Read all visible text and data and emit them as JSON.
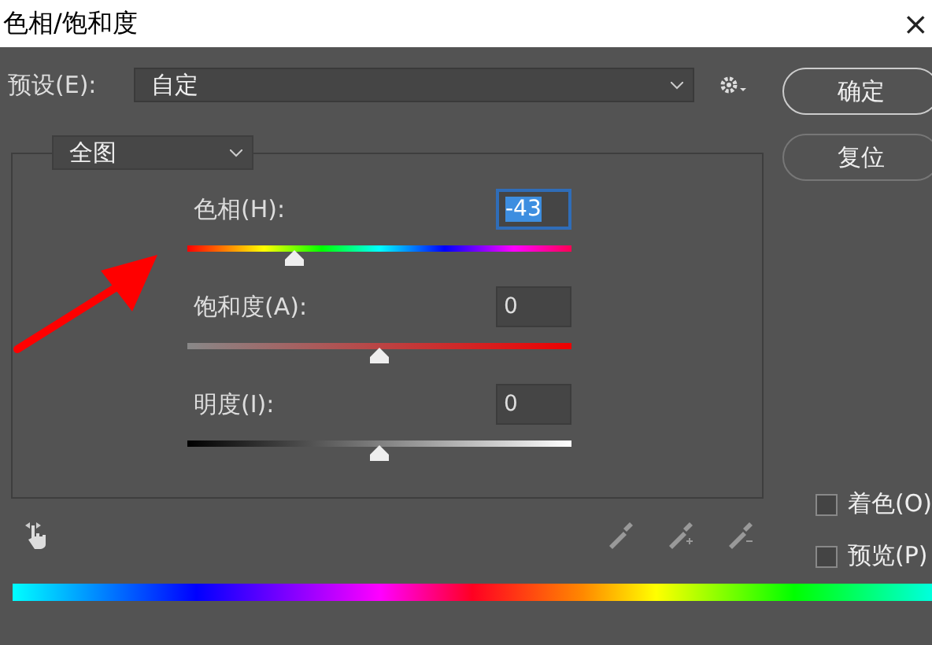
{
  "window": {
    "title": "色相/饱和度",
    "close": "×"
  },
  "preset": {
    "label": "预设(E):",
    "value": "自定"
  },
  "buttons": [
    {
      "label": "确定",
      "default": true
    },
    {
      "label": "复位",
      "default": false
    }
  ],
  "channel": {
    "value": "全图"
  },
  "sliders": [
    {
      "kind": "hue",
      "label": "色相(H):",
      "value": "-43",
      "focused": true,
      "level": 0.28
    },
    {
      "kind": "saturation",
      "label": "饱和度(A):",
      "value": "0",
      "focused": false,
      "level": 0.5
    },
    {
      "kind": "lightness",
      "label": "明度(I):",
      "value": "0",
      "focused": false,
      "level": 0.5
    }
  ],
  "options": [
    {
      "label": "着色(O)",
      "checked": false
    },
    {
      "label": "预览(P)",
      "checked": false
    }
  ]
}
